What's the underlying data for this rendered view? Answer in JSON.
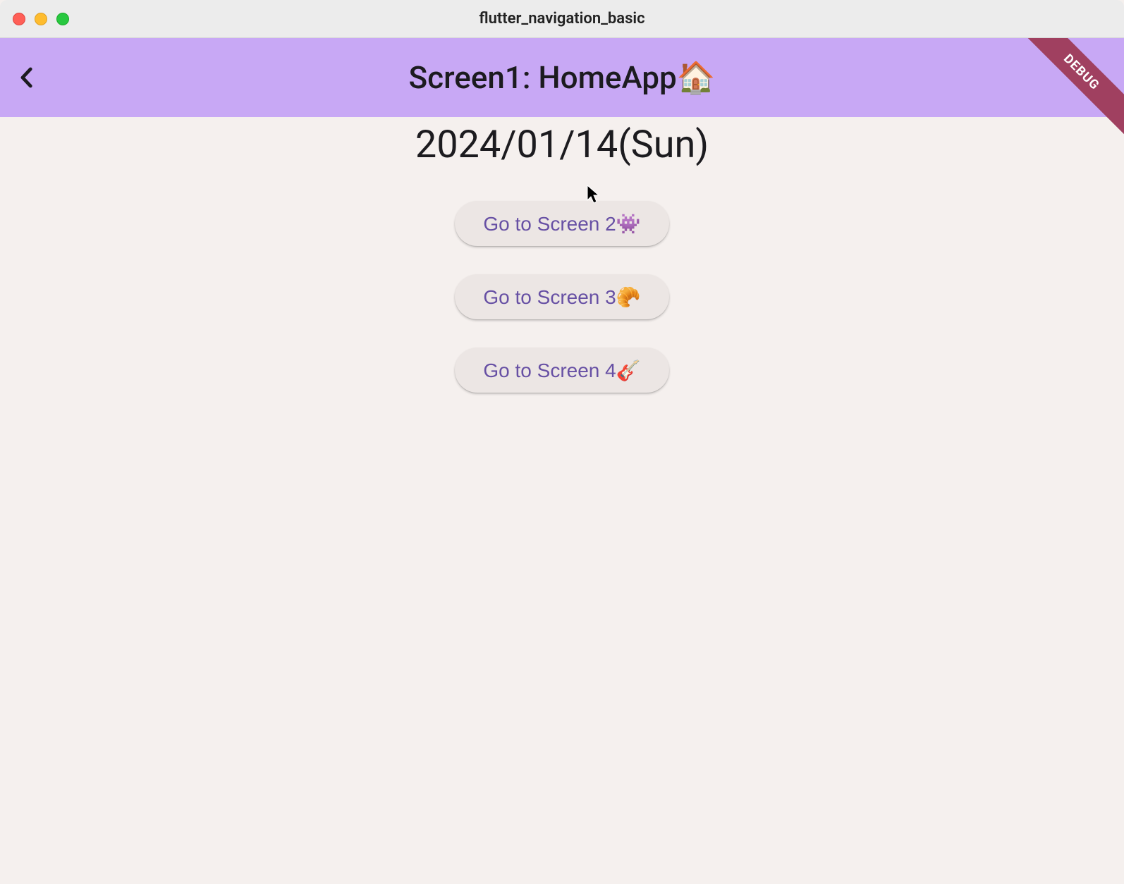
{
  "window": {
    "title": "flutter_navigation_basic"
  },
  "appbar": {
    "title": "Screen1: HomeApp🏠"
  },
  "debug_banner": "DEBUG",
  "content": {
    "date": "2024/01/14(Sun)",
    "buttons": [
      {
        "label": "Go to Screen 2👾"
      },
      {
        "label": "Go to Screen 3🥐"
      },
      {
        "label": "Go to Screen 4🎸"
      }
    ]
  }
}
